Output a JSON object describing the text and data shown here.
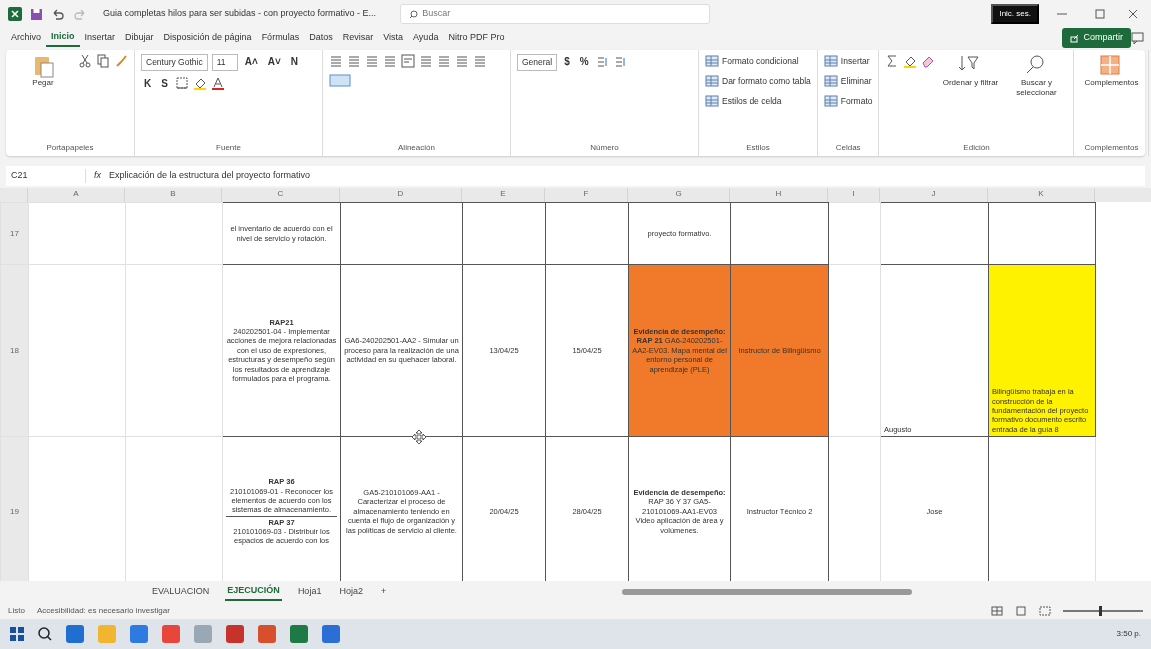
{
  "window": {
    "title": "Guia completas hilos para ser subidas - con proyecto formativo - E...",
    "search_placeholder": "Buscar",
    "account": "Inic. ses."
  },
  "menu_tabs": [
    {
      "label": "Archivo",
      "selected": false
    },
    {
      "label": "Inicio",
      "selected": true
    },
    {
      "label": "Insertar",
      "selected": false
    },
    {
      "label": "Dibujar",
      "selected": false
    },
    {
      "label": "Disposición de página",
      "selected": false
    },
    {
      "label": "Fórmulas",
      "selected": false
    },
    {
      "label": "Datos",
      "selected": false
    },
    {
      "label": "Revisar",
      "selected": false
    },
    {
      "label": "Vista",
      "selected": false
    },
    {
      "label": "Ayuda",
      "selected": false
    },
    {
      "label": "Nitro PDF Pro",
      "selected": false
    }
  ],
  "share_button": "Compartir",
  "ribbon": [
    {
      "name": "Portapapeles",
      "items": [
        {
          "kind": "large",
          "label": "Pegar"
        },
        {
          "kind": "icon"
        },
        {
          "kind": "icon"
        },
        {
          "kind": "icon"
        }
      ]
    },
    {
      "name": "Fuente",
      "items": [
        {
          "kind": "combo",
          "value": "Century Gothic"
        },
        {
          "kind": "combo",
          "value": "11"
        },
        {
          "kind": "glyph",
          "label": "A˄"
        },
        {
          "kind": "glyph",
          "label": "A˅"
        },
        {
          "kind": "glyph",
          "label": "N"
        },
        {
          "kind": "glyph",
          "label": "K"
        },
        {
          "kind": "glyph",
          "label": "S"
        },
        {
          "kind": "icon"
        },
        {
          "kind": "icon"
        },
        {
          "kind": "icon"
        }
      ]
    },
    {
      "name": "Alineación",
      "items": [
        {
          "kind": "icon"
        },
        {
          "kind": "icon"
        },
        {
          "kind": "icon"
        },
        {
          "kind": "icon"
        },
        {
          "kind": "icon"
        },
        {
          "kind": "icon"
        },
        {
          "kind": "icon"
        },
        {
          "kind": "icon"
        },
        {
          "kind": "icon"
        },
        {
          "kind": "icon"
        }
      ]
    },
    {
      "name": "Número",
      "items": [
        {
          "kind": "combo",
          "value": "General"
        },
        {
          "kind": "glyph",
          "label": "$"
        },
        {
          "kind": "glyph",
          "label": "%"
        },
        {
          "kind": "icon"
        },
        {
          "kind": "icon"
        }
      ]
    },
    {
      "name": "Estilos",
      "items": [
        {
          "kind": "small",
          "label": "Formato condicional"
        },
        {
          "kind": "small",
          "label": "Dar formato como tabla"
        },
        {
          "kind": "small",
          "label": "Estilos de celda"
        }
      ]
    },
    {
      "name": "Celdas",
      "items": [
        {
          "kind": "small",
          "label": "Insertar"
        },
        {
          "kind": "small",
          "label": "Eliminar"
        },
        {
          "kind": "small",
          "label": "Formato"
        }
      ]
    },
    {
      "name": "Edición",
      "items": [
        {
          "kind": "icon"
        },
        {
          "kind": "icon"
        },
        {
          "kind": "icon"
        },
        {
          "kind": "large",
          "label": "Ordenar y filtrar"
        },
        {
          "kind": "large",
          "label": "Buscar y seleccionar"
        }
      ]
    },
    {
      "name": "Complementos",
      "items": [
        {
          "kind": "large",
          "label": "Complementos"
        }
      ]
    }
  ],
  "formula_bar": {
    "name_box": "C21",
    "fx": "fx",
    "formula": "Explicación de la estructura del proyecto formativo"
  },
  "grid": {
    "columns": [
      "A",
      "B",
      "C",
      "D",
      "E",
      "F",
      "G",
      "H",
      "I",
      "J",
      "K"
    ],
    "rows": [
      {
        "number": "17",
        "cells": [
          {},
          {},
          {
            "text": "el inventario de acuerdo con el nivel de servicio y rotación."
          },
          {},
          {},
          {},
          {
            "text": "proyecto formativo."
          },
          {},
          {},
          {},
          {}
        ]
      },
      {
        "number": "18",
        "cells": [
          {},
          {},
          {
            "parts": [
              "**RAP21**\n240202501-04 - Implementar acciones de mejora relacionadas con el uso de expresiones, estructuras y desempeño según los resultados de aprendizaje formulados para el programa."
            ]
          },
          {
            "text": "GA6-240202501-AA2 - Simular un proceso para la realización de una actividad en su quehacer laboral."
          },
          {
            "text": "13/04/25"
          },
          {
            "text": "15/04/25"
          },
          {
            "text": "**Evidencia de desempeño:**\n**RAP 21** GA6-240202501-AA2-EV03. Mapa mental del entorno personal de aprendizaje (PLE)",
            "color": "#f07a2a"
          },
          {
            "text": "Instructor de Bilingüismo",
            "color": "#f07a2a"
          },
          {},
          {
            "text": "Augusto"
          },
          {
            "text": "Bilingüismo trabaja en la construcción de la fundamentación del proyecto formativo documento escrito entrada de la guía 8",
            "color": "#fff200"
          }
        ]
      },
      {
        "number": "19",
        "cells": [
          {},
          {},
          {
            "parts": [
              "**RAP 36**\n210101069-01 - Reconocer los elementos de acuerdo con los sistemas de almacenamiento.",
              "**RAP 37**\n210101069-03 - Distribuir los espacios de acuerdo con los"
            ]
          },
          {
            "text": "GA5-210101069-AA1 - Caracterizar el proceso de almacenamiento teniendo en cuenta el flujo de organización y las políticas de servicio al cliente."
          },
          {
            "text": "20/04/25"
          },
          {
            "text": "28/04/25"
          },
          {
            "text": "**Evidencia de desempeño:**\nRAP 36 Y 37 GA5-210101069-AA1-EV03 Video aplicación de área y volúmenes."
          },
          {
            "text": "Instructor Técnico 2"
          },
          {},
          {
            "text": "Jose"
          },
          {}
        ]
      }
    ]
  },
  "sheet_tabs": [
    {
      "label": "EVALUACION",
      "selected": false
    },
    {
      "label": "EJECUCIÓN",
      "selected": true
    },
    {
      "label": "Hoja1",
      "selected": false
    },
    {
      "label": "Hoja2",
      "selected": false
    }
  ],
  "add_sheet": "+",
  "status_bar": {
    "mode": "Listo",
    "accessibility": "Accesibilidad: es necesario investigar",
    "zoom": {
      "level": 0.45
    }
  },
  "taskbar": {
    "apps": [
      {
        "color": "#1f6fd1"
      },
      {
        "color": "#f2b530"
      },
      {
        "color": "#2d7be0"
      },
      {
        "color": "#e8453c"
      },
      {
        "color": "#9aa7b4"
      },
      {
        "color": "#c5332a"
      },
      {
        "color": "#d8502b"
      },
      {
        "color": "#1d7a45"
      },
      {
        "color": "#2b6fd6"
      }
    ],
    "time": "3:50 p."
  }
}
